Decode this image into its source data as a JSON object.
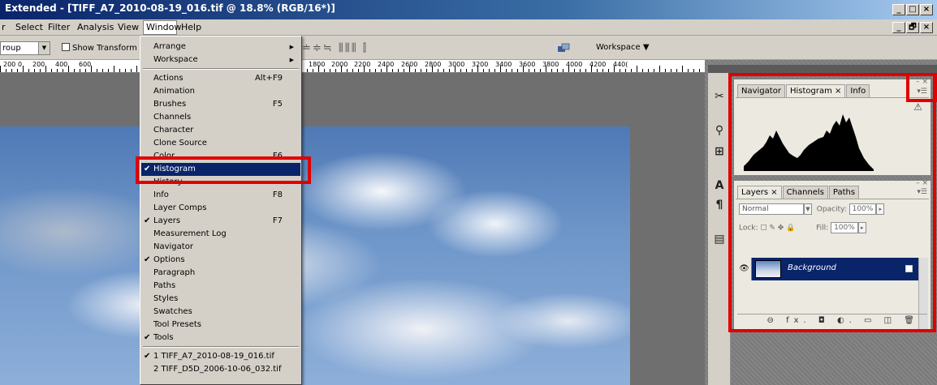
{
  "window": {
    "title": "Extended - [TIFF_A7_2010-08-19_016.tif @ 18.8% (RGB/16*)]",
    "minimize": "_",
    "maximize": "□",
    "close": "×",
    "restore": "🗗"
  },
  "menubar": [
    "r",
    "Select",
    "Filter",
    "Analysis",
    "View",
    "Window",
    "Help"
  ],
  "options": {
    "group_select": "roup",
    "show_transform": "Show Transform C",
    "workspace": "Workspace ▼"
  },
  "ruler": {
    "labels": [
      "200",
      "0",
      "200",
      "400",
      "600",
      "1800",
      "2000",
      "2200",
      "2400",
      "2600",
      "2800",
      "3000",
      "3200",
      "3400",
      "3600",
      "3800",
      "4000",
      "4200",
      "440("
    ]
  },
  "window_menu": {
    "groups": [
      [
        {
          "label": "Arrange",
          "submenu": true
        },
        {
          "label": "Workspace",
          "submenu": true
        }
      ],
      [
        {
          "label": "Actions",
          "shortcut": "Alt+F9"
        },
        {
          "label": "Animation"
        },
        {
          "label": "Brushes",
          "shortcut": "F5"
        },
        {
          "label": "Channels"
        },
        {
          "label": "Character"
        },
        {
          "label": "Clone Source"
        },
        {
          "label": "Color",
          "shortcut": "F6"
        },
        {
          "label": "Histogram",
          "checked": true,
          "highlighted": true
        },
        {
          "label": "History"
        },
        {
          "label": "Info",
          "shortcut": "F8"
        },
        {
          "label": "Layer Comps"
        },
        {
          "label": "Layers",
          "shortcut": "F7",
          "checked": true
        },
        {
          "label": "Measurement Log"
        },
        {
          "label": "Navigator"
        },
        {
          "label": "Options",
          "checked": true
        },
        {
          "label": "Paragraph"
        },
        {
          "label": "Paths"
        },
        {
          "label": "Styles"
        },
        {
          "label": "Swatches"
        },
        {
          "label": "Tool Presets"
        },
        {
          "label": "Tools",
          "checked": true
        }
      ],
      [
        {
          "label": "1 TIFF_A7_2010-08-19_016.tif",
          "checked": true
        },
        {
          "label": "2 TIFF_D5D_2006-10-06_032.tif"
        }
      ]
    ]
  },
  "histogram_panel": {
    "tabs": [
      "Navigator",
      "Histogram ×",
      "Info"
    ],
    "warning_icon": "⚠"
  },
  "layers_panel": {
    "tabs": [
      "Layers ×",
      "Channels",
      "Paths"
    ],
    "blend_mode": "Normal",
    "opacity_label": "Opacity:",
    "opacity_value": "100%",
    "lock_label": "Lock:",
    "fill_label": "Fill:",
    "fill_value": "100%",
    "layer_name": "Background",
    "footer_icons": "⊖ fx. ◘ ◐. ▭ ◫ 🗑"
  },
  "colors": {
    "highlight": "#0a246a",
    "annotation": "#e00000"
  }
}
